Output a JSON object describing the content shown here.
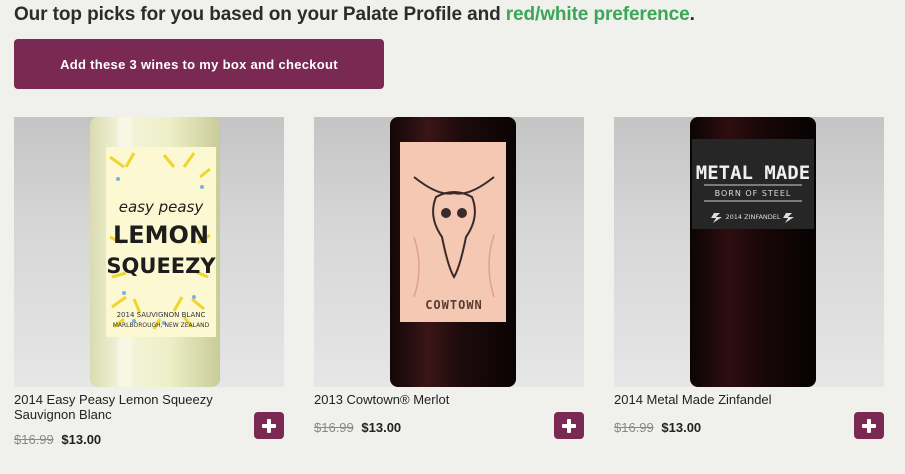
{
  "header": {
    "text_before": "Our top picks for you based on your Palate Profile and ",
    "highlight": "red/white preference",
    "text_after": "."
  },
  "checkout_button": {
    "label": "Add these 3 wines to my box and checkout"
  },
  "colors": {
    "accent": "#7a2a52",
    "highlight": "#3aa657",
    "background": "#f0f0ec"
  },
  "products": [
    {
      "name": "2014 Easy Peasy Lemon Squeezy Sauvignon Blanc",
      "old_price": "$16.99",
      "price": "$13.00",
      "image_icon": "white-wine-bottle-icon",
      "label_lines": [
        "easy peasy",
        "LEMON",
        "SQUEEZY"
      ],
      "label_sub": "2014 SAUVIGNON BLANC",
      "label_sub2": "MARLBOROUGH, NEW ZEALAND"
    },
    {
      "name": "2013 Cowtown® Merlot",
      "old_price": "$16.99",
      "price": "$13.00",
      "image_icon": "red-wine-bottle-icon",
      "label_brand": "COWTOWN"
    },
    {
      "name": "2014 Metal Made Zinfandel",
      "old_price": "$16.99",
      "price": "$13.00",
      "image_icon": "red-wine-bottle-icon",
      "label_brand": "METAL MADE",
      "label_tagline": "BORN OF STEEL",
      "label_varietal": "2014 ZINFANDEL"
    }
  ]
}
